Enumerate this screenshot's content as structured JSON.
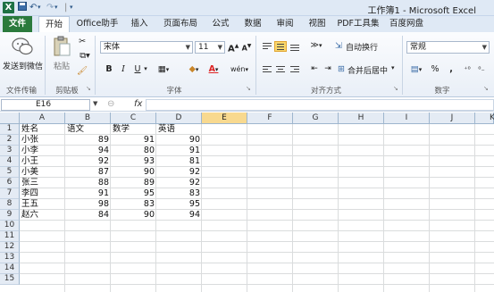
{
  "title_bar": {
    "app_icon": "excel-icon",
    "title": "工作簿1 - Microsoft Excel",
    "qa_icons": [
      "save-icon",
      "undo-icon",
      "redo-icon",
      "customize-qat-icon"
    ]
  },
  "tabs": [
    "文件",
    "开始",
    "Office助手",
    "插入",
    "页面布局",
    "公式",
    "数据",
    "审阅",
    "视图",
    "PDF工具集",
    "百度网盘"
  ],
  "ribbon": {
    "wechat": {
      "label": "发送到微信",
      "group": "文件传输"
    },
    "clipboard": {
      "paste": "粘贴",
      "group": "剪贴板"
    },
    "font": {
      "name": "宋体",
      "size": "11",
      "grow": "A",
      "shrink": "A",
      "bold": "B",
      "italic": "I",
      "underline": "U",
      "font_color": "A",
      "phonetic": "wén",
      "group": "字体"
    },
    "alignment": {
      "wrap": "自动换行",
      "merge": "合并后居中",
      "group": "对齐方式"
    },
    "number": {
      "format": "常规",
      "percent": "%",
      "comma": ",",
      "group": "数字"
    }
  },
  "formula_bar": {
    "name_box": "E16",
    "fx": "fx",
    "content": ""
  },
  "columns": [
    "A",
    "B",
    "C",
    "D",
    "E",
    "F",
    "G",
    "H",
    "I",
    "J",
    "K"
  ],
  "rows": [
    "1",
    "2",
    "3",
    "4",
    "5",
    "6",
    "7",
    "8",
    "9",
    "10",
    "11",
    "12",
    "13",
    "14",
    "15"
  ],
  "sheet": {
    "headers": [
      "姓名",
      "语文",
      "数学",
      "英语"
    ],
    "records": [
      {
        "name": "小张",
        "chinese": "89",
        "math": "91",
        "english": "90"
      },
      {
        "name": "小李",
        "chinese": "94",
        "math": "80",
        "english": "91"
      },
      {
        "name": "小王",
        "chinese": "92",
        "math": "93",
        "english": "81"
      },
      {
        "name": "小美",
        "chinese": "87",
        "math": "90",
        "english": "92"
      },
      {
        "name": "张三",
        "chinese": "88",
        "math": "89",
        "english": "92"
      },
      {
        "name": "李四",
        "chinese": "91",
        "math": "95",
        "english": "83"
      },
      {
        "name": "王五",
        "chinese": "98",
        "math": "83",
        "english": "95"
      },
      {
        "name": "赵六",
        "chinese": "84",
        "math": "90",
        "english": "94"
      }
    ]
  }
}
